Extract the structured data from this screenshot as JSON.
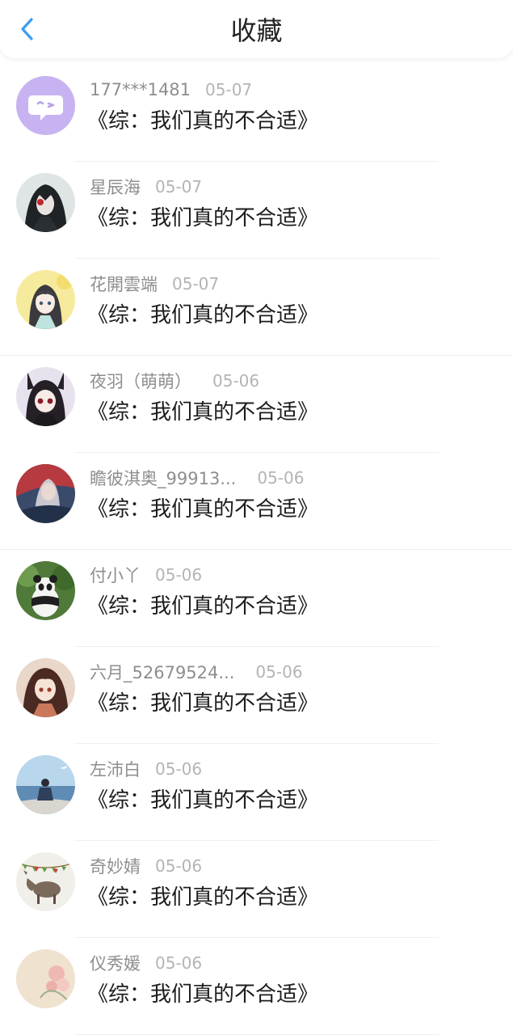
{
  "header": {
    "title": "收藏",
    "back_icon": "chevron-left-icon",
    "accent": "#3d9bf0"
  },
  "items": [
    {
      "user": "177***1481",
      "date": "05-07",
      "title": "《综：我们真的不合适》",
      "avatar": "chat-bubble-icon"
    },
    {
      "user": "星辰海",
      "date": "05-07",
      "title": "《综：我们真的不合适》",
      "avatar": "anime-character"
    },
    {
      "user": "花開雲端",
      "date": "05-07",
      "title": "《综：我们真的不合适》",
      "avatar": "anime-character"
    },
    {
      "user": "夜羽（萌萌）",
      "date": "05-06",
      "title": "《综：我们真的不合适》",
      "avatar": "anime-character"
    },
    {
      "user": "瞻彼淇奥_99913...",
      "date": "05-06",
      "title": "《综：我们真的不合适》",
      "avatar": "illustration"
    },
    {
      "user": "付小丫",
      "date": "05-06",
      "title": "《综：我们真的不合适》",
      "avatar": "panda-photo"
    },
    {
      "user": "六月_52679524...",
      "date": "05-06",
      "title": "《综：我们真的不合适》",
      "avatar": "anime-character"
    },
    {
      "user": "左沛白",
      "date": "05-06",
      "title": "《综：我们真的不合适》",
      "avatar": "seaside-photo"
    },
    {
      "user": "奇妙婧",
      "date": "05-06",
      "title": "《综：我们真的不合适》",
      "avatar": "donkey-cartoon"
    },
    {
      "user": "仪秀媛",
      "date": "05-06",
      "title": "《综：我们真的不合适》",
      "avatar": "flower-illustration"
    }
  ]
}
